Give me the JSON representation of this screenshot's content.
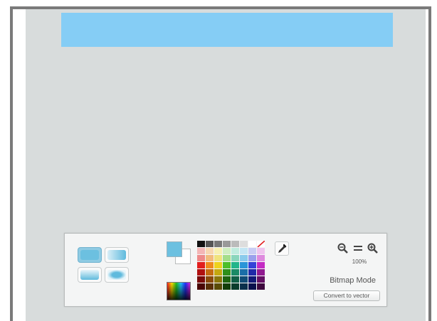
{
  "icons": {
    "zoom_out": "zoom-out-icon",
    "zoom_reset": "zoom-reset-icon",
    "zoom_in": "zoom-in-icon",
    "eyedropper": "eyedropper-icon",
    "no_color": "no-color-icon"
  },
  "canvas": {
    "background": "#d8dcdc",
    "shape_color": "#85cdf5"
  },
  "color_panel": {
    "fill_color": "#6cc0e0",
    "stroke_color": "#ffffff",
    "palette": [
      "#111111",
      "#555555",
      "#777777",
      "#999999",
      "#bbbbbb",
      "#dddddd",
      "#ffffff",
      "#ffffff",
      "#f4b6b6",
      "#f7d7b0",
      "#f7f0b0",
      "#cfeec0",
      "#c0ecde",
      "#c4e6f4",
      "#c9cdf4",
      "#efc4ee",
      "#ee8a8a",
      "#f2bb7c",
      "#f0e37c",
      "#a4de8a",
      "#8ad6bc",
      "#8acbec",
      "#9aa0ec",
      "#de8ade",
      "#e21d1d",
      "#ee8a1d",
      "#eed21d",
      "#4dbf2a",
      "#22b58a",
      "#2a96d8",
      "#3442d8",
      "#c42ac4",
      "#b01010",
      "#c46a10",
      "#c4a810",
      "#2f8f1a",
      "#1a8a66",
      "#1a6ea8",
      "#1f2aa8",
      "#901a90",
      "#7a0a0a",
      "#8a4a0a",
      "#8a760a",
      "#1e6410",
      "#105f46",
      "#104c76",
      "#121a76",
      "#641064",
      "#4a0606",
      "#5a3006",
      "#5a4c06",
      "#123e0a",
      "#0a3c2c",
      "#0a304c",
      "#0a104c",
      "#3e0a3e"
    ]
  },
  "zoom": {
    "level": "100%"
  },
  "mode": {
    "label": "Bitmap Mode",
    "convert_label": "Convert to vector"
  }
}
